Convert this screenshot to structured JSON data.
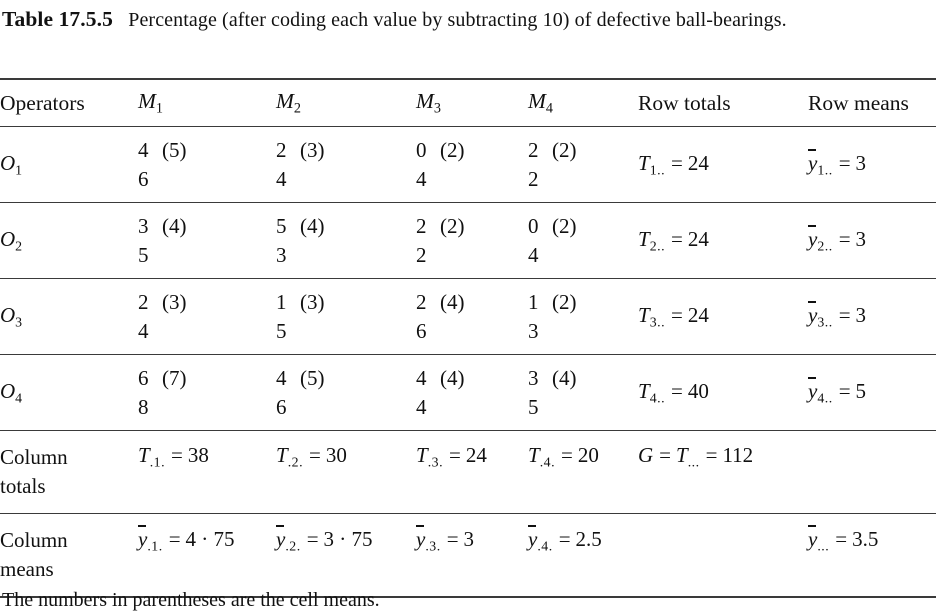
{
  "caption": {
    "label": "Table 17.5.5",
    "text": "Percentage (after coding each value by subtracting 10) of defective ball-bearings."
  },
  "table": {
    "headers": {
      "operators": "Operators",
      "m1": "M",
      "m1_sub": "1",
      "m2": "M",
      "m2_sub": "2",
      "m3": "M",
      "m3_sub": "3",
      "m4": "M",
      "m4_sub": "4",
      "row_totals": "Row totals",
      "row_means": "Row means"
    },
    "rows": [
      {
        "label": "O",
        "label_sub": "1",
        "cells": [
          {
            "v1": "4",
            "mean": "(5)",
            "v2": "6"
          },
          {
            "v1": "2",
            "mean": "(3)",
            "v2": "4"
          },
          {
            "v1": "0",
            "mean": "(2)",
            "v2": "4"
          },
          {
            "v1": "2",
            "mean": "(2)",
            "v2": "2"
          }
        ],
        "total_sym": "T",
        "total_sub": "1..",
        "total_eq": "=",
        "total_val": "24",
        "mean_sym": "y",
        "mean_sub": "1..",
        "mean_eq": "=",
        "mean_val": "3"
      },
      {
        "label": "O",
        "label_sub": "2",
        "cells": [
          {
            "v1": "3",
            "mean": "(4)",
            "v2": "5"
          },
          {
            "v1": "5",
            "mean": "(4)",
            "v2": "3"
          },
          {
            "v1": "2",
            "mean": "(2)",
            "v2": "2"
          },
          {
            "v1": "0",
            "mean": "(2)",
            "v2": "4"
          }
        ],
        "total_sym": "T",
        "total_sub": "2..",
        "total_eq": "=",
        "total_val": "24",
        "mean_sym": "y",
        "mean_sub": "2..",
        "mean_eq": "=",
        "mean_val": "3"
      },
      {
        "label": "O",
        "label_sub": "3",
        "cells": [
          {
            "v1": "2",
            "mean": "(3)",
            "v2": "4"
          },
          {
            "v1": "1",
            "mean": "(3)",
            "v2": "5"
          },
          {
            "v1": "2",
            "mean": "(4)",
            "v2": "6"
          },
          {
            "v1": "1",
            "mean": "(2)",
            "v2": "3"
          }
        ],
        "total_sym": "T",
        "total_sub": "3..",
        "total_eq": "=",
        "total_val": "24",
        "mean_sym": "y",
        "mean_sub": "3..",
        "mean_eq": "=",
        "mean_val": "3"
      },
      {
        "label": "O",
        "label_sub": "4",
        "cells": [
          {
            "v1": "6",
            "mean": "(7)",
            "v2": "8"
          },
          {
            "v1": "4",
            "mean": "(5)",
            "v2": "6"
          },
          {
            "v1": "4",
            "mean": "(4)",
            "v2": "4"
          },
          {
            "v1": "3",
            "mean": "(4)",
            "v2": "5"
          }
        ],
        "total_sym": "T",
        "total_sub": "4..",
        "total_eq": "=",
        "total_val": "40",
        "mean_sym": "y",
        "mean_sub": "4..",
        "mean_eq": "=",
        "mean_val": "5"
      }
    ],
    "column_totals": {
      "label_line1": "Column",
      "label_line2": "totals",
      "cols": [
        {
          "sym": "T",
          "sub": ".1.",
          "eq": "=",
          "val": "38"
        },
        {
          "sym": "T",
          "sub": ".2.",
          "eq": "=",
          "val": "30"
        },
        {
          "sym": "T",
          "sub": ".3.",
          "eq": "=",
          "val": "24"
        },
        {
          "sym": "T",
          "sub": ".4.",
          "eq": "=",
          "val": "20"
        }
      ],
      "grand": {
        "g_sym": "G",
        "eq1": "=",
        "sym": "T",
        "sub": "...",
        "eq2": "=",
        "val": "112"
      }
    },
    "column_means": {
      "label_line1": "Column",
      "label_line2": "means",
      "cols": [
        {
          "sym": "y",
          "sub": ".1.",
          "eq": "=",
          "val": "4 · 75"
        },
        {
          "sym": "y",
          "sub": ".2.",
          "eq": "=",
          "val": "3 · 75"
        },
        {
          "sym": "y",
          "sub": ".3.",
          "eq": "=",
          "val": "3"
        },
        {
          "sym": "y",
          "sub": ".4.",
          "eq": "=",
          "val": "2.5"
        }
      ],
      "grand": {
        "sym": "y",
        "sub": "...",
        "eq": "=",
        "val": "3.5"
      }
    }
  },
  "footnote": "The numbers in parentheses are the cell means."
}
